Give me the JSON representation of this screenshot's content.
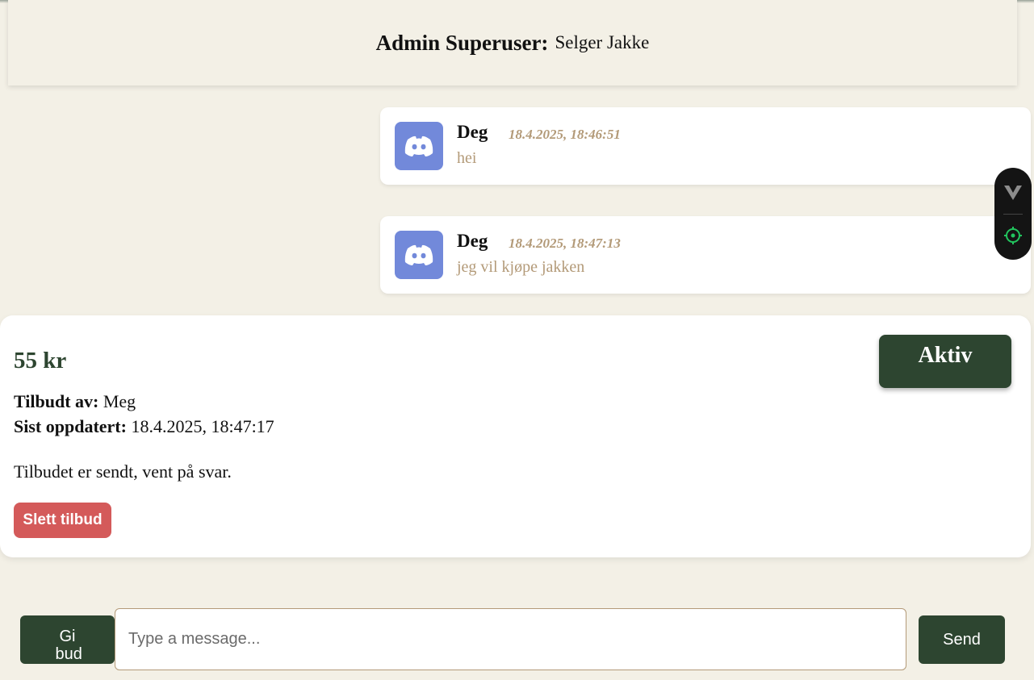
{
  "header": {
    "role_label": "Admin Superuser:",
    "name": "Selger Jakke"
  },
  "messages": [
    {
      "author": "Deg",
      "timestamp": "18.4.2025, 18:46:51",
      "text": "hei",
      "avatar_icon": "discord-logo-icon"
    },
    {
      "author": "Deg",
      "timestamp": "18.4.2025, 18:47:13",
      "text": "jeg vil kjøpe jakken",
      "avatar_icon": "discord-logo-icon"
    }
  ],
  "offer": {
    "price": "55 kr",
    "status": "Aktiv",
    "offered_by_label": "Tilbudt av:",
    "offered_by": "Meg",
    "updated_label": "Sist oppdatert:",
    "updated": "18.4.2025, 18:47:17",
    "note": "Tilbudet er sendt, vent på svar.",
    "delete_label": "Slett tilbud"
  },
  "composer": {
    "bid_label_line1": "Gi",
    "bid_label_line2": "bud",
    "placeholder": "Type a message...",
    "value": "",
    "send_label": "Send"
  },
  "widget": {
    "icons": [
      "v-logo-icon",
      "crosshair-icon"
    ]
  },
  "colors": {
    "background": "#f3f0e6",
    "accent": "#2d4530",
    "avatar": "#7289da",
    "muted_text": "#b39a78",
    "danger": "#d45a5a"
  }
}
